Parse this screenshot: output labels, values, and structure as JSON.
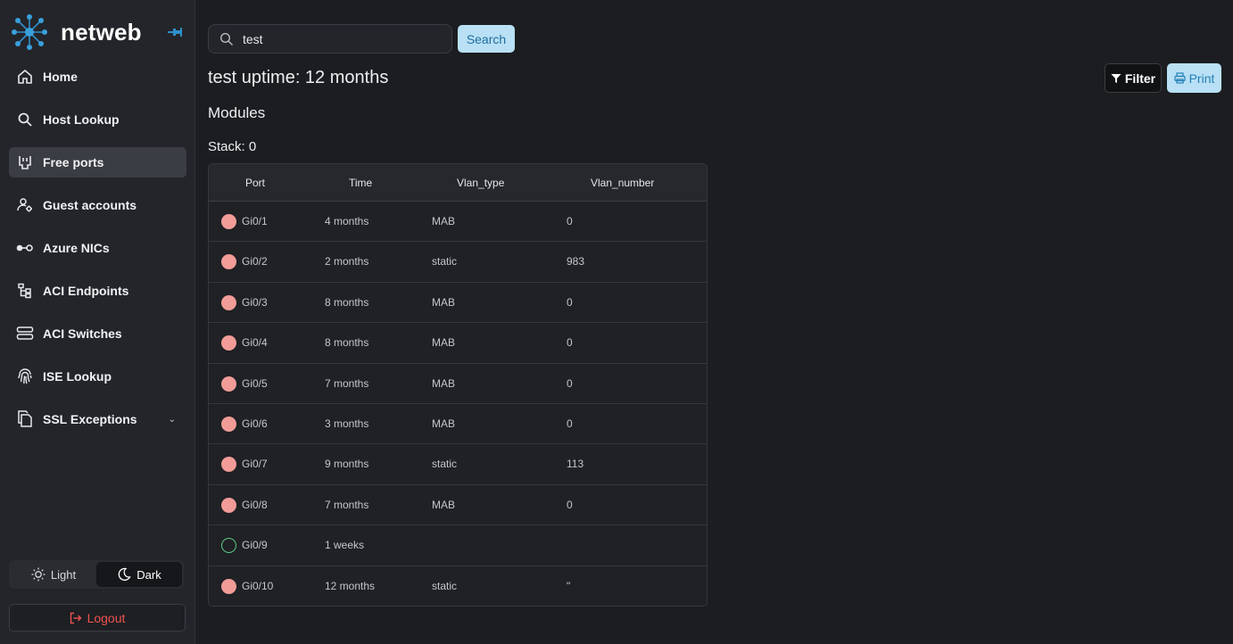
{
  "brand": {
    "name": "netweb"
  },
  "nav": [
    {
      "label": "Home",
      "icon": "home-icon",
      "active": false
    },
    {
      "label": "Host Lookup",
      "icon": "search-icon",
      "active": false
    },
    {
      "label": "Free ports",
      "icon": "ethernet-port-icon",
      "active": true
    },
    {
      "label": "Guest accounts",
      "icon": "user-gear-icon",
      "active": false
    },
    {
      "label": "Azure NICs",
      "icon": "network-link-icon",
      "active": false
    },
    {
      "label": "ACI Endpoints",
      "icon": "tree-icon",
      "active": false
    },
    {
      "label": "ACI Switches",
      "icon": "server-icon",
      "active": false
    },
    {
      "label": "ISE Lookup",
      "icon": "fingerprint-icon",
      "active": false
    },
    {
      "label": "SSL Exceptions",
      "icon": "document-icon",
      "active": false,
      "expandable": true
    }
  ],
  "theme": {
    "light_label": "Light",
    "dark_label": "Dark",
    "selected": "Dark"
  },
  "logout_label": "Logout",
  "search": {
    "value": "test",
    "button_label": "Search"
  },
  "page": {
    "title": "test uptime: 12 months",
    "section": "Modules",
    "stack": "Stack: 0"
  },
  "actions": {
    "filter_label": "Filter",
    "print_label": "Print"
  },
  "table": {
    "columns": [
      "Port",
      "Time",
      "Vlan_type",
      "Vlan_number"
    ],
    "rows": [
      {
        "status": "used",
        "port": "Gi0/1",
        "time": "4 months",
        "vlan_type": "MAB",
        "vlan_number": "0"
      },
      {
        "status": "used",
        "port": "Gi0/2",
        "time": "2 months",
        "vlan_type": "static",
        "vlan_number": "983"
      },
      {
        "status": "used",
        "port": "Gi0/3",
        "time": "8 months",
        "vlan_type": "MAB",
        "vlan_number": "0"
      },
      {
        "status": "used",
        "port": "Gi0/4",
        "time": "8 months",
        "vlan_type": "MAB",
        "vlan_number": "0"
      },
      {
        "status": "used",
        "port": "Gi0/5",
        "time": "7 months",
        "vlan_type": "MAB",
        "vlan_number": "0"
      },
      {
        "status": "used",
        "port": "Gi0/6",
        "time": "3 months",
        "vlan_type": "MAB",
        "vlan_number": "0"
      },
      {
        "status": "used",
        "port": "Gi0/7",
        "time": "9 months",
        "vlan_type": "static",
        "vlan_number": "113"
      },
      {
        "status": "used",
        "port": "Gi0/8",
        "time": "7 months",
        "vlan_type": "MAB",
        "vlan_number": "0"
      },
      {
        "status": "free",
        "port": "Gi0/9",
        "time": "1 weeks",
        "vlan_type": "",
        "vlan_number": ""
      },
      {
        "status": "used",
        "port": "Gi0/10",
        "time": "12 months",
        "vlan_type": "static",
        "vlan_number": "\""
      }
    ]
  },
  "colors": {
    "accent": "#2f8fcb",
    "used_port": "#f29c98",
    "free_port": "#5ec98a",
    "logout": "#ef5350"
  }
}
